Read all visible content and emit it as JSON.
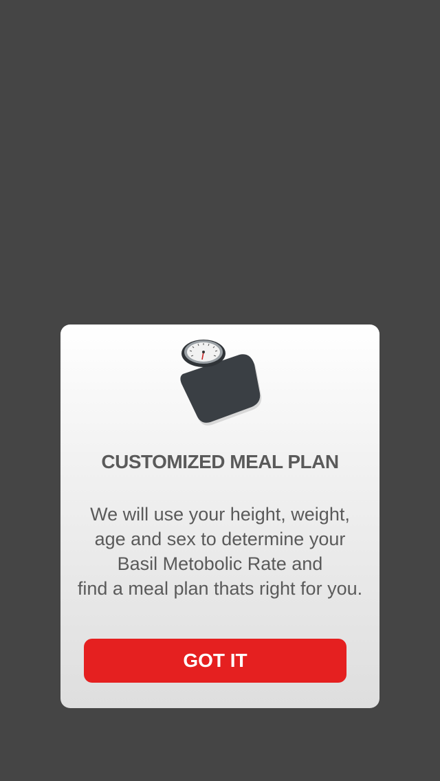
{
  "dialog": {
    "title": "CUSTOMIZED MEAL PLAN",
    "description_lines": [
      "We will use your height, weight,",
      "age and sex to determine your",
      "Basil Metobolic Rate and",
      "find a meal plan thats right for you."
    ],
    "icon": "bathroom-scale-icon",
    "button_label": "GOT IT"
  },
  "colors": {
    "background": "#454545",
    "accent": "#e52020",
    "text": "#5a5a5a"
  }
}
